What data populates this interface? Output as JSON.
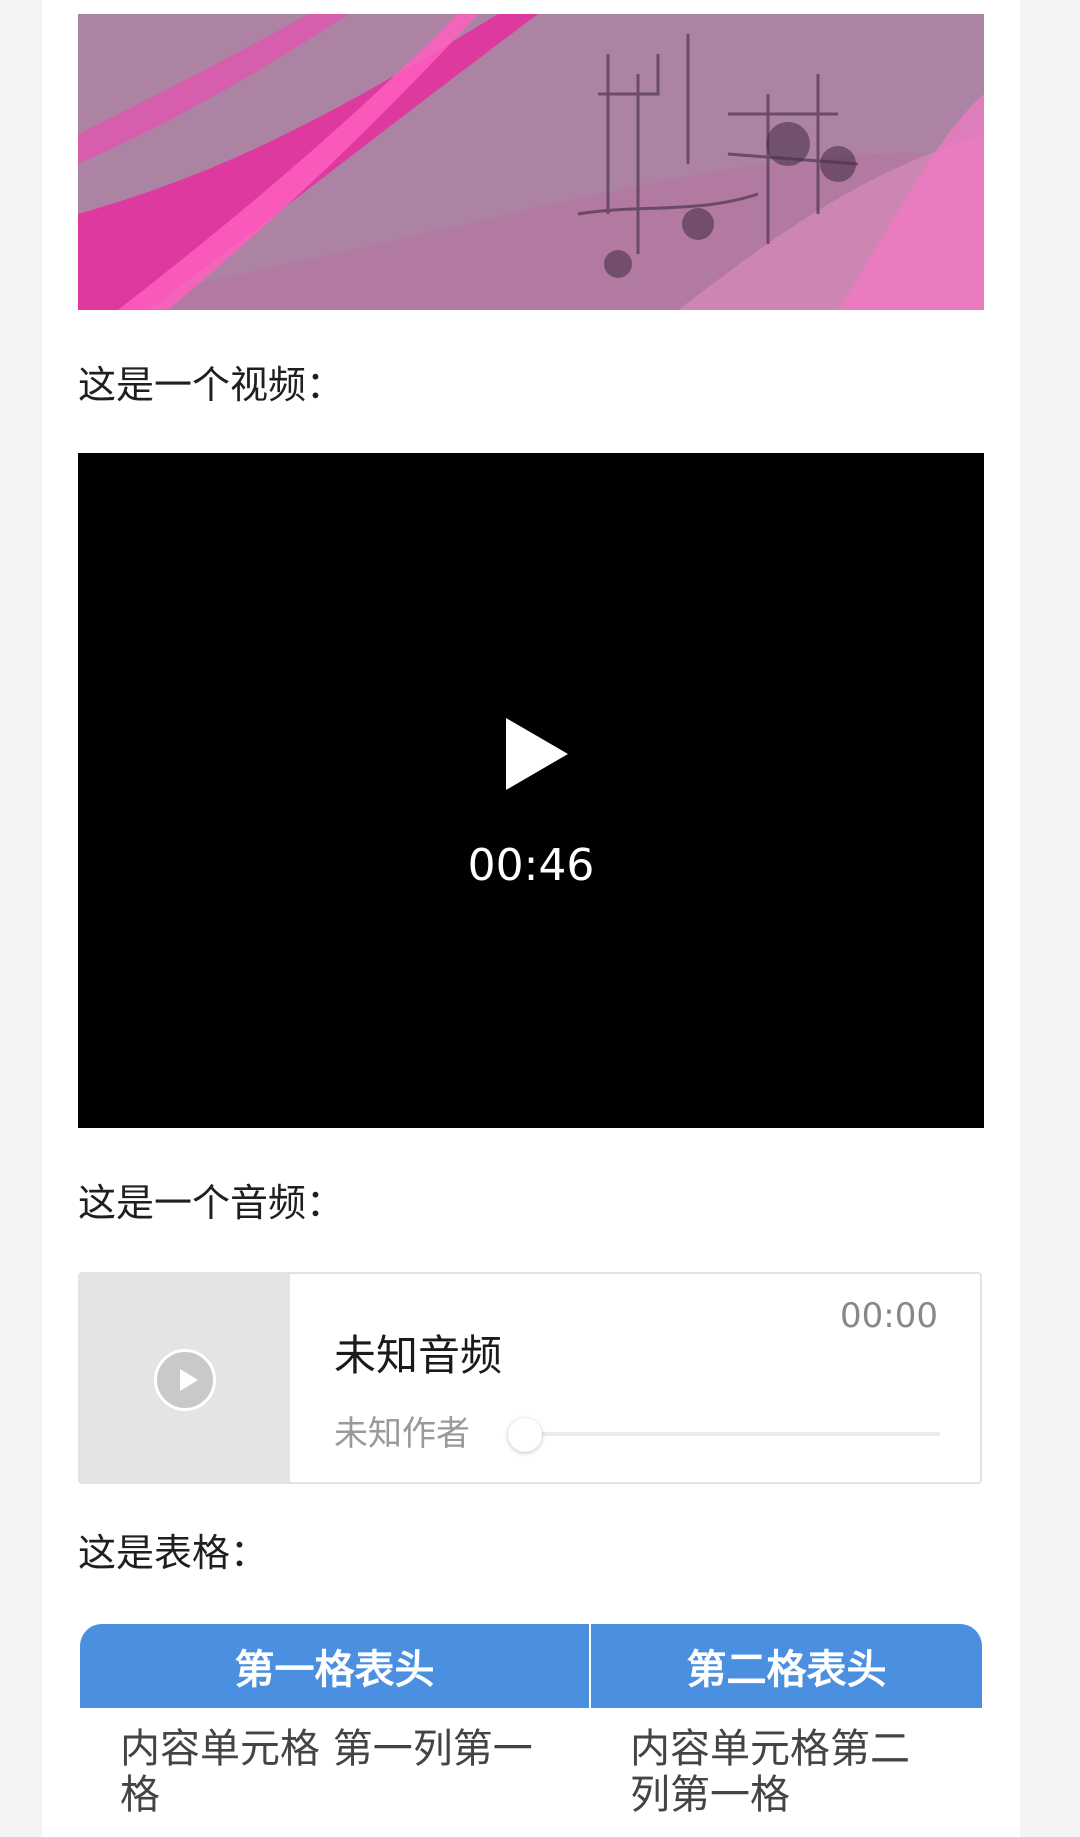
{
  "sections": {
    "video_label": "这是一个视频：",
    "audio_label": "这是一个音频：",
    "table_label": "这是表格："
  },
  "video": {
    "duration": "00:46"
  },
  "audio": {
    "title": "未知音频",
    "author": "未知作者",
    "time": "00:00",
    "progress": 0
  },
  "table": {
    "headers": [
      "第一格表头",
      "第二格表头"
    ],
    "rows": [
      [
        "内容单元格 第一列第一格",
        "内容单元格第二列第一格"
      ]
    ]
  },
  "icons": {
    "video_play": "play-icon",
    "audio_play": "play-circle-icon"
  }
}
